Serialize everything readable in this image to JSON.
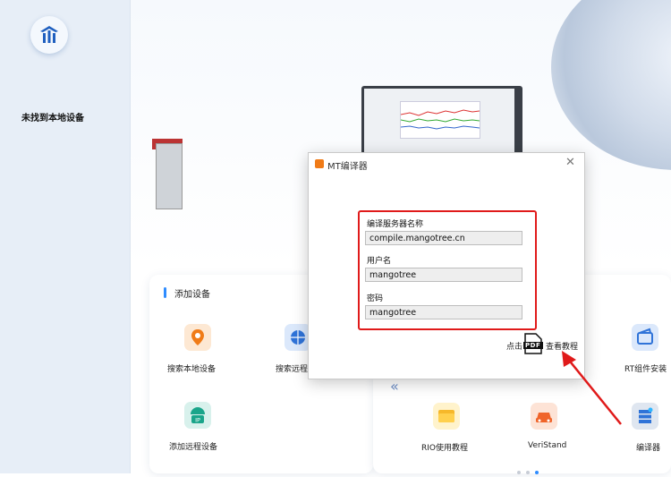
{
  "sidebar": {
    "status_text": "未找到本地设备"
  },
  "add_device": {
    "title": "添加设备",
    "items": [
      {
        "label": "搜索本地设备",
        "icon": "location-pin-icon"
      },
      {
        "label": "搜索远程",
        "icon": "globe-icon"
      },
      {
        "label": "添加远程设备",
        "icon": "ip-network-icon"
      }
    ]
  },
  "tools": {
    "items": [
      {
        "label": "RT组件安装",
        "icon": "wallet-install-icon"
      },
      {
        "label": "RIO使用教程",
        "icon": "folder-icon"
      },
      {
        "label": "VeriStand",
        "icon": "car-icon"
      },
      {
        "label": "编译器",
        "icon": "server-icon"
      }
    ]
  },
  "dialog": {
    "title": "MT编译器",
    "fields": [
      {
        "label": "编译服务器名称",
        "value": "compile.mangotree.cn"
      },
      {
        "label": "用户名",
        "value": "mangotree"
      },
      {
        "label": "密码",
        "value": "mangotree"
      }
    ],
    "click_text": "点击",
    "tutorial_link": "查看教程",
    "pdf_icon_text": "PDF"
  },
  "colors": {
    "accent": "#2f8cff",
    "highlight": "#e01a1a",
    "orange": "#f07b17"
  }
}
